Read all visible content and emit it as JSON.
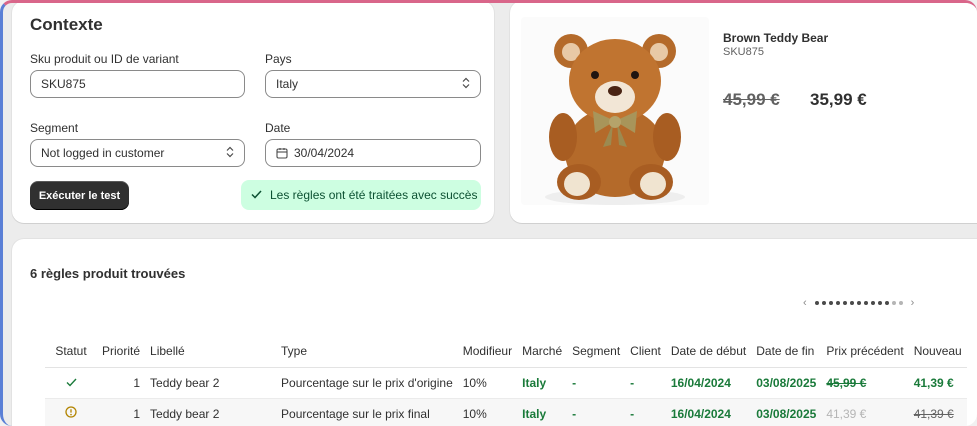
{
  "context": {
    "title": "Contexte",
    "sku_label": "Sku produit ou ID de variant",
    "sku_value": "SKU875",
    "country_label": "Pays",
    "country_value": "Italy",
    "segment_label": "Segment",
    "segment_value": "Not logged in customer",
    "date_label": "Date",
    "date_value": "30/04/2024",
    "run_button": "Exécuter le test",
    "success_message": "Les règles ont été traitées avec succès"
  },
  "product": {
    "name": "Brown Teddy Bear",
    "sku": "SKU875",
    "old_price": "45,99 €",
    "new_price": "35,99 €"
  },
  "rules": {
    "title": "6 règles produit trouvées",
    "pager_prev": "‹",
    "pager_next": "›",
    "columns": [
      "Statut",
      "Priorité",
      "Libellé",
      "Type",
      "Modifieur",
      "Marché",
      "Segment",
      "Client",
      "Date de début",
      "Date de fin",
      "Prix précédent",
      "Nouveau"
    ],
    "rows": [
      {
        "status": "success",
        "priority": "1",
        "label": "Teddy bear 2",
        "type": "Pourcentage sur le prix d'origine",
        "modifier": "10%",
        "market": "Italy",
        "segment": "-",
        "client": "-",
        "start": "16/04/2024",
        "end": "03/08/2025",
        "prev_price": "45,99 €",
        "new_price": "41,39 €"
      },
      {
        "status": "warning",
        "priority": "1",
        "label": "Teddy bear 2",
        "type": "Pourcentage sur le prix final",
        "modifier": "10%",
        "market": "Italy",
        "segment": "-",
        "client": "-",
        "start": "16/04/2024",
        "end": "03/08/2025",
        "prev_price": "41,39 €",
        "new_price": "41,39 €"
      }
    ]
  },
  "colors": {
    "success_bg": "#cdfee1",
    "success_text": "#0c5132",
    "accent_green": "#1a7a3a",
    "warning": "#b28400",
    "button_dark": "#303030"
  }
}
